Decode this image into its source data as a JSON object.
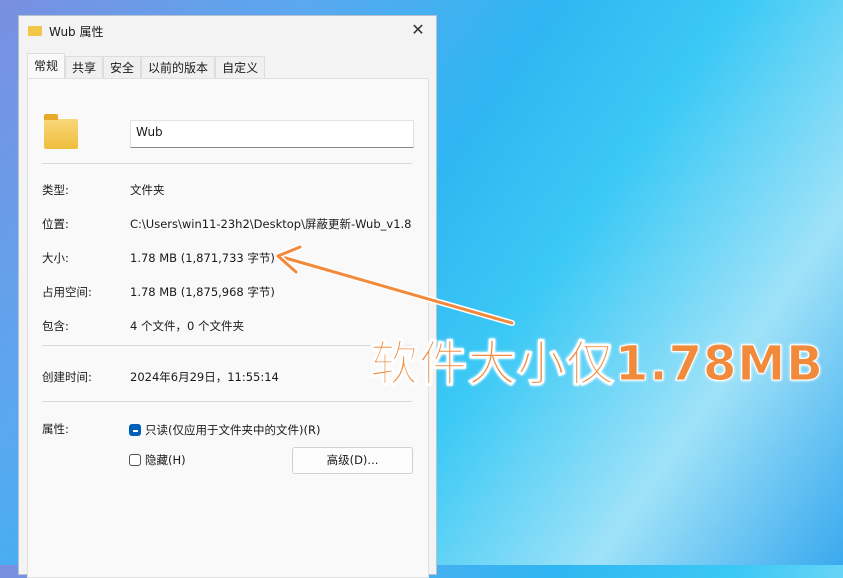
{
  "window": {
    "title": "Wub 属性",
    "close": "✕"
  },
  "tabs": [
    "常规",
    "共享",
    "安全",
    "以前的版本",
    "自定义"
  ],
  "general": {
    "name": "Wub",
    "type_label": "类型:",
    "type_value": "文件夹",
    "location_label": "位置:",
    "location_value": "C:\\Users\\win11-23h2\\Desktop\\屏蔽更新-Wub_v1.8",
    "size_label": "大小:",
    "size_value": "1.78 MB (1,871,733 字节)",
    "disk_label": "占用空间:",
    "disk_value": "1.78 MB (1,875,968 字节)",
    "contains_label": "包含:",
    "contains_value": "4 个文件，0 个文件夹",
    "created_label": "创建时间:",
    "created_value": "2024年6月29日，11:55:14",
    "attr_label": "属性:",
    "readonly_label": "只读(仅应用于文件夹中的文件)(R)",
    "hidden_label": "隐藏(H)",
    "advanced_button": "高级(D)..."
  },
  "annotation": {
    "text": "软件大小仅1.78MB",
    "color": "#f28a3c"
  }
}
